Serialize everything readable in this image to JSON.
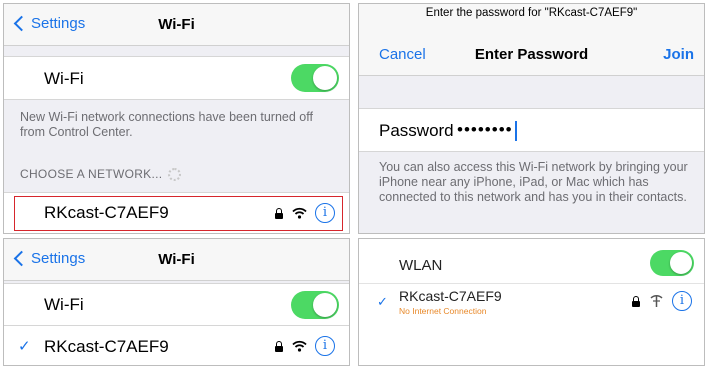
{
  "panel1": {
    "back_label": "Settings",
    "title": "Wi-Fi",
    "wifi_label": "Wi-Fi",
    "wifi_on": true,
    "note": "New Wi-Fi network connections have been turned off from Control Center.",
    "section_header": "CHOOSE A NETWORK...",
    "network_name": "RKcast-C7AEF9",
    "info_glyph": "i"
  },
  "panel2": {
    "prompt": "Enter the password for \"RKcast-C7AEF9\"",
    "cancel_label": "Cancel",
    "title": "Enter Password",
    "join_label": "Join",
    "password_label": "Password",
    "password_mask": "••••••••",
    "note": "You can also access this Wi-Fi network by bringing your iPhone near any iPhone, iPad, or Mac which has connected to this network and has you in their contacts."
  },
  "panel3": {
    "back_label": "Settings",
    "title": "Wi-Fi",
    "wifi_label": "Wi-Fi",
    "wifi_on": true,
    "check": "✓",
    "network_name": "RKcast-C7AEF9",
    "info_glyph": "i"
  },
  "panel4": {
    "wlan_label": "WLAN",
    "wlan_on": true,
    "check": "✓",
    "network_name": "RKcast-C7AEF9",
    "network_status": "No Internet Connection",
    "info_glyph": "i"
  },
  "colors": {
    "accent_blue": "#1a73e8",
    "toggle_green": "#4cd964",
    "highlight_red": "#d6262c",
    "warning_orange": "#e8892a"
  }
}
